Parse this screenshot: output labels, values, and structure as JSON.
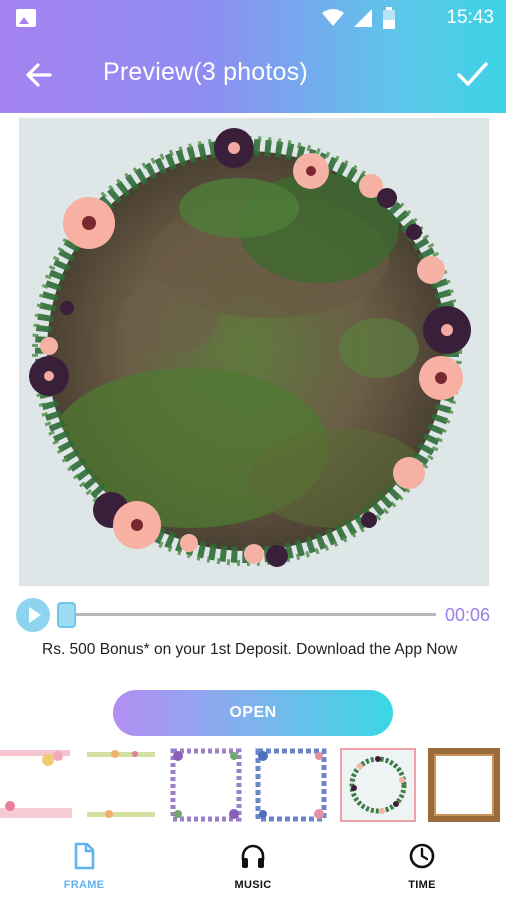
{
  "status_bar": {
    "time": "15:43"
  },
  "header": {
    "title": "Preview(3 photos)",
    "back_icon": "arrow-left-icon",
    "confirm_icon": "check-icon"
  },
  "player": {
    "elapsed": "00:06",
    "progress_fraction": 0.0
  },
  "ad": {
    "text": "Rs. 500 Bonus* on your 1st Deposit. Download the App Now",
    "button_label": "OPEN"
  },
  "frames": {
    "selected_index": 4,
    "count": 6
  },
  "bottom_nav": {
    "items": [
      {
        "label": "FRAME",
        "icon": "document-icon",
        "active": true
      },
      {
        "label": "MUSIC",
        "icon": "headphones-icon",
        "active": false
      },
      {
        "label": "TIME",
        "icon": "clock-icon",
        "active": false
      }
    ]
  },
  "colors": {
    "accent_purple": "#a583f0",
    "accent_cyan": "#3dd3e6",
    "active_nav": "#5fb3ef",
    "selected_frame": "#f1a0a9"
  }
}
